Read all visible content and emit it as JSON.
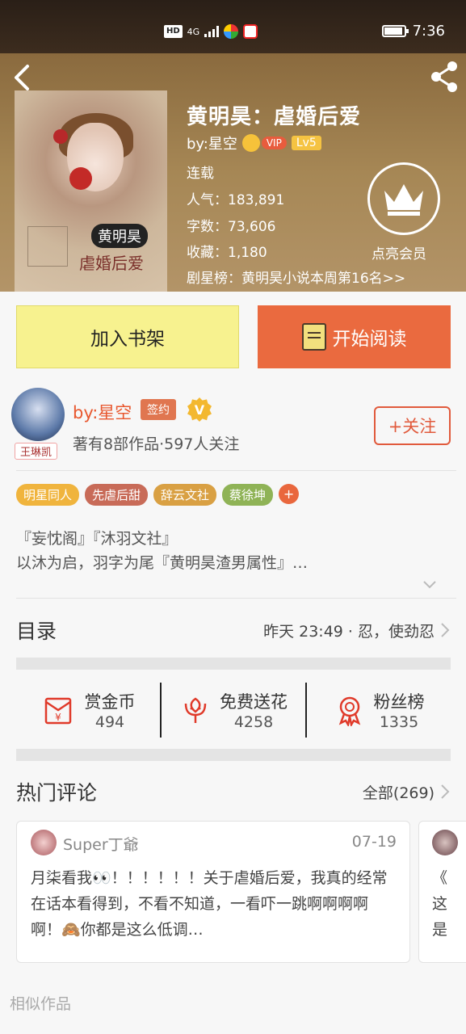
{
  "status_bar": {
    "hd": "HD",
    "net": "4G",
    "time": "7:36",
    "battery": 0.85
  },
  "book": {
    "title": "黄明昊：虐婚后爱",
    "author": "by:星空",
    "vip": "VIP",
    "level": "Lv5",
    "status": "连载",
    "popularity": "人气：183,891",
    "words": "字数：73,606",
    "favorites": "收藏：1,180",
    "rank": "剧星榜：黄明昊小说本周第16名>>",
    "crown_label": "点亮会员",
    "cover": {
      "name_tag": "黄明昊",
      "subtitle": "虐婚后爱"
    }
  },
  "actions": {
    "shelf": "加入书架",
    "read": "开始阅读"
  },
  "author": {
    "name": "by:星空",
    "sign": "签约",
    "v": "V",
    "stats": "著有8部作品·597人关注",
    "badge": "王琳凯",
    "follow": "+关注"
  },
  "tags": [
    {
      "label": "明星同人",
      "color": "#f0b43d"
    },
    {
      "label": "先虐后甜",
      "color": "#c86b58"
    },
    {
      "label": "辞云文社",
      "color": "#d9a043"
    },
    {
      "label": "蔡徐坤",
      "color": "#8fb356"
    }
  ],
  "tag_add": "+",
  "description": {
    "line1": "『妄忱阁』『沐羽文社』",
    "line2": "以沐为启，羽字为尾『黄明昊渣男属性』…"
  },
  "toc": {
    "title": "目录",
    "latest": "昨天 23:49 · 忍，使劲忍"
  },
  "stats": [
    {
      "label": "赏金币",
      "value": "494",
      "icon": "red-envelope-icon"
    },
    {
      "label": "免费送花",
      "value": "4258",
      "icon": "flower-icon"
    },
    {
      "label": "粉丝榜",
      "value": "1335",
      "icon": "medal-icon"
    }
  ],
  "comments": {
    "title": "热门评论",
    "all": "全部(269)",
    "items": [
      {
        "user": "Super丁爺",
        "date": "07-19",
        "text": "月柒看我👀！！！！！！关于虐婚后爱，我真的经常在话本看得到，不看不知道，一看吓一跳啊啊啊啊啊！🙈你都是这么低调…"
      },
      {
        "partial_text": "《\n这\n是"
      }
    ]
  },
  "similar": "相似作品",
  "colors": {
    "accent": "#e8572e",
    "read_button": "#ea6a3f",
    "shelf_button": "#f7f28f"
  }
}
